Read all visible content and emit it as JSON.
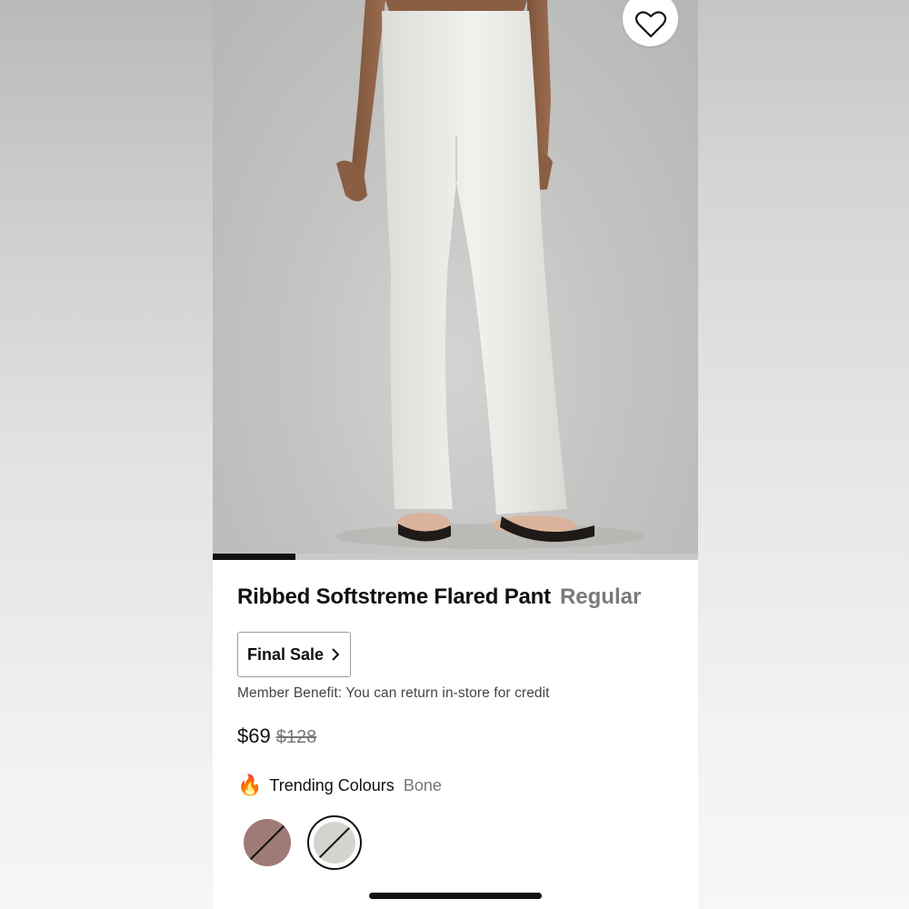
{
  "product": {
    "name": "Ribbed Softstreme Flared Pant",
    "fit": "Regular",
    "final_sale_label": "Final Sale",
    "member_benefit": "Member Benefit: You can return in-store for credit",
    "price": {
      "current": "$69",
      "original": "$128"
    },
    "trending": {
      "label": "Trending Colours",
      "selected_colour": "Bone"
    }
  },
  "gallery": {
    "progress": 0.17
  },
  "icons": {
    "wishlist": "heart-icon",
    "final_sale_chevron": "chevron-right-icon",
    "trending": "fire-icon"
  },
  "swatches": [
    {
      "colour": "#a07a76",
      "selected": false,
      "unavailable": true
    },
    {
      "colour": "#d4d3cd",
      "selected": true,
      "unavailable": true
    }
  ],
  "colors": {
    "text": "#111111",
    "muted": "#777777",
    "accent": "#111111"
  }
}
